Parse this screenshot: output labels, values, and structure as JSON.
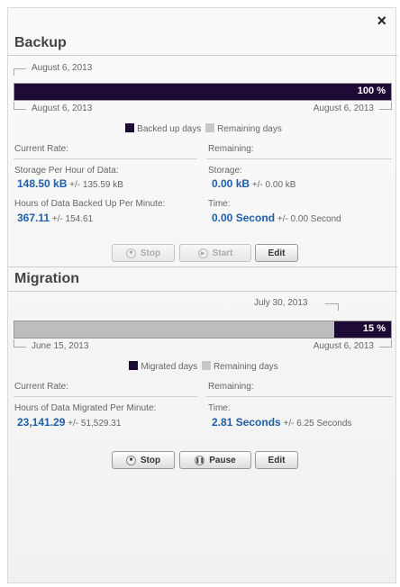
{
  "close_label": "×",
  "backup": {
    "title": "Backup",
    "top_date": "August 6, 2013",
    "percent_label": "100 %",
    "progress": 1.0,
    "start_date": "August 6, 2013",
    "end_date": "August 6, 2013",
    "legend": {
      "done": "Backed up days",
      "remaining": "Remaining days"
    },
    "current_rate_label": "Current Rate:",
    "remaining_label": "Remaining:",
    "storage_per_hour_label": "Storage Per Hour of Data:",
    "storage_per_hour_value": "148.50 kB",
    "storage_per_hour_err": "+/- 135.59 kB",
    "storage_label": "Storage:",
    "storage_value": "0.00 kB",
    "storage_err": "+/- 0.00 kB",
    "hours_per_min_label": "Hours of Data Backed Up Per Minute:",
    "hours_per_min_value": "367.11",
    "hours_per_min_err": "+/- 154.61",
    "time_label": "Time:",
    "time_value": "0.00 Second",
    "time_err": "+/- 0.00 Second",
    "buttons": {
      "stop": "Stop",
      "start": "Start",
      "edit": "Edit"
    }
  },
  "migration": {
    "title": "Migration",
    "top_date": "July 30, 2013",
    "percent_label": "15 %",
    "progress": 0.15,
    "start_date": "June 15, 2013",
    "end_date": "August 6, 2013",
    "legend": {
      "done": "Migrated days",
      "remaining": "Remaining days"
    },
    "current_rate_label": "Current Rate:",
    "remaining_label": "Remaining:",
    "hours_per_min_label": "Hours of Data Migrated Per Minute:",
    "hours_per_min_value": "23,141.29",
    "hours_per_min_err": "+/- 51,529.31",
    "time_label": "Time:",
    "time_value": "2.81 Seconds",
    "time_err": "+/- 6.25 Seconds",
    "buttons": {
      "stop": "Stop",
      "pause": "Pause",
      "edit": "Edit"
    }
  },
  "colors": {
    "progress_fill": "#1e0a36",
    "remaining": "#c8c8c8",
    "value_blue": "#1f5fa8"
  }
}
